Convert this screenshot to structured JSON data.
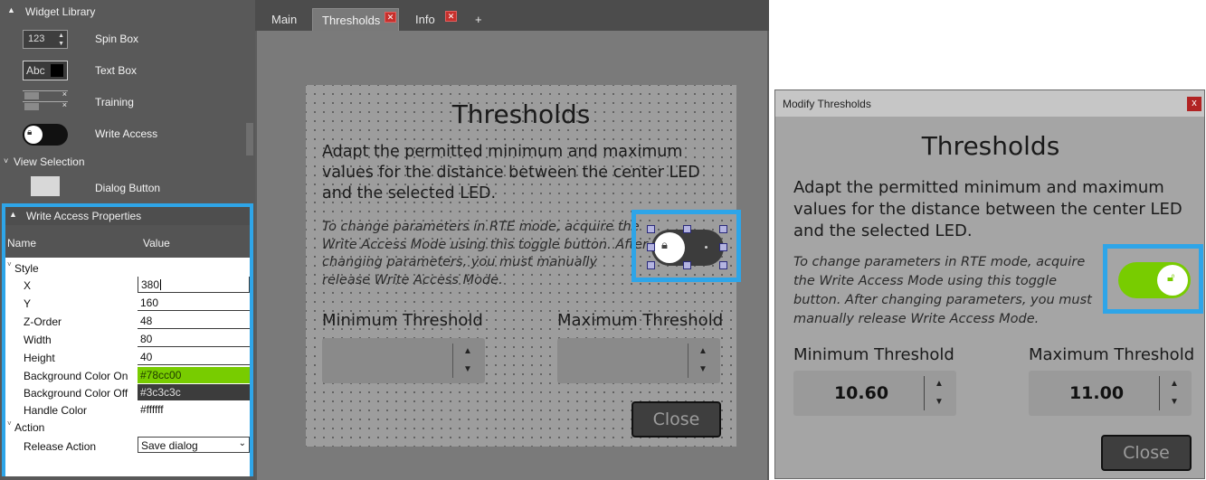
{
  "widget_library": {
    "title": "Widget Library",
    "items": [
      {
        "label": "Spin Box",
        "icon": "spin-box-icon",
        "preview_text": "123"
      },
      {
        "label": "Text Box",
        "icon": "text-box-icon",
        "preview_text": "Abc"
      },
      {
        "label": "Training",
        "icon": "training-icon"
      },
      {
        "label": "Write Access",
        "icon": "write-access-icon"
      }
    ],
    "view_selection": {
      "title": "View Selection"
    },
    "dialog_button": {
      "label": "Dialog Button"
    }
  },
  "properties": {
    "title": "Write Access Properties",
    "col_name": "Name",
    "col_value": "Value",
    "group_style": "Style",
    "group_action": "Action",
    "rows": [
      {
        "name": "X",
        "value": "380"
      },
      {
        "name": "Y",
        "value": "160"
      },
      {
        "name": "Z-Order",
        "value": "48"
      },
      {
        "name": "Width",
        "value": "80"
      },
      {
        "name": "Height",
        "value": "40"
      },
      {
        "name": "Background Color On",
        "value": "#78cc00"
      },
      {
        "name": "Background Color Off",
        "value": "#3c3c3c"
      },
      {
        "name": "Handle Color",
        "value": "#ffffff"
      }
    ],
    "release_action": {
      "name": "Release Action",
      "value": "Save dialog"
    }
  },
  "tabs": [
    {
      "label": "Main"
    },
    {
      "label": "Thresholds"
    },
    {
      "label": "Info"
    },
    {
      "label": "+"
    }
  ],
  "canvas": {
    "title": "Thresholds",
    "description": "Adapt the permitted minimum and maximum values for the distance between the center LED and the selected LED.",
    "note": "To change parameters in RTE mode, acquire the Write Access Mode using this toggle button. After changing parameters, you must manually release Write Access Mode.",
    "min_label": "Minimum Threshold",
    "max_label": "Maximum Threshold",
    "close_label": "Close"
  },
  "dialog": {
    "window_title": "Modify Thresholds",
    "title": "Thresholds",
    "description": "Adapt the permitted minimum and maximum values for the distance between the center LED and the selected LED.",
    "note": "To change parameters in RTE mode, acquire the Write Access Mode using this toggle button. After changing parameters, you must manually release Write Access Mode.",
    "min_label": "Minimum Threshold",
    "max_label": "Maximum Threshold",
    "min_value": "10.60",
    "max_value": "11.00",
    "close_label": "Close"
  },
  "colors": {
    "highlight": "#2ea5e8",
    "toggle_on": "#78cc00",
    "toggle_off": "#3c3c3c",
    "handle": "#ffffff"
  }
}
